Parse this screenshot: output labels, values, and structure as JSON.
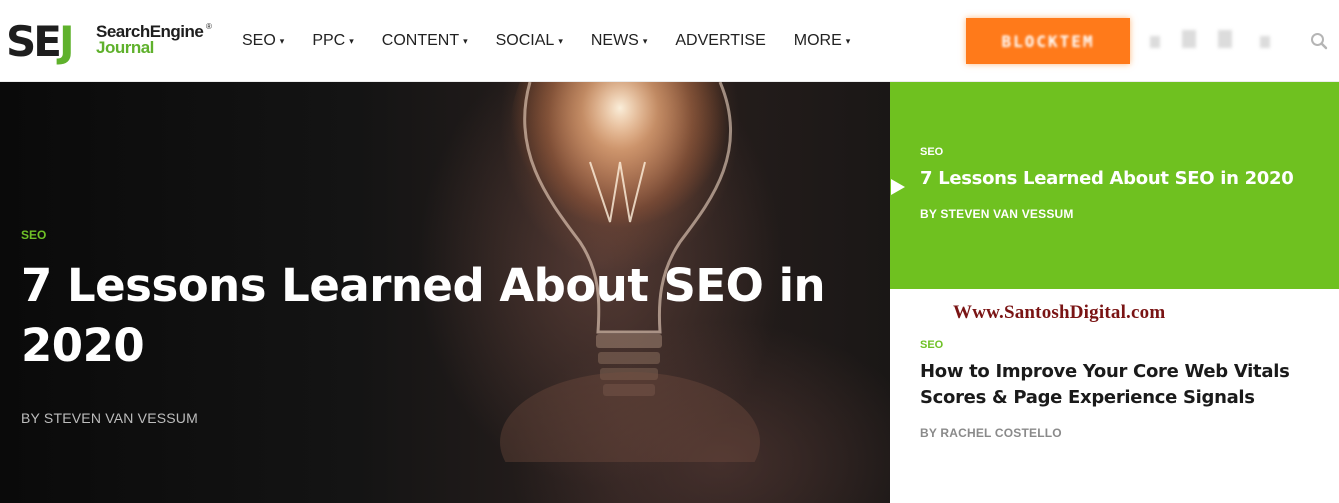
{
  "brand": {
    "logo_mark_s": "SE",
    "logo_mark_j": "J",
    "logo_line1": "SearchEngine",
    "logo_line2": "Journal",
    "logo_reg": "®",
    "accent_color": "#6fc126",
    "cta_color": "#ff7a1a"
  },
  "nav": {
    "items": [
      {
        "label": "SEO",
        "has_dropdown": true
      },
      {
        "label": "PPC",
        "has_dropdown": true
      },
      {
        "label": "CONTENT",
        "has_dropdown": true
      },
      {
        "label": "SOCIAL",
        "has_dropdown": true
      },
      {
        "label": "NEWS",
        "has_dropdown": true
      },
      {
        "label": "ADVERTISE",
        "has_dropdown": false
      },
      {
        "label": "MORE",
        "has_dropdown": true
      }
    ],
    "caret": "▾",
    "cta_label": "BLOCKTEM"
  },
  "hero": {
    "category": "SEO",
    "title": "7 Lessons Learned About SEO in 2020",
    "author": "BY STEVEN VAN VESSUM"
  },
  "sidebar": {
    "featured": {
      "category": "SEO",
      "title": "7 Lessons Learned About SEO in 2020",
      "author": "BY STEVEN VAN VESSUM",
      "bg_color": "#6fc120"
    },
    "watermark": "Www.SantoshDigital.com",
    "second": {
      "category": "SEO",
      "title": "How to Improve Your Core Web Vitals Scores & Page Experience Signals",
      "author": "BY RACHEL COSTELLO"
    }
  }
}
